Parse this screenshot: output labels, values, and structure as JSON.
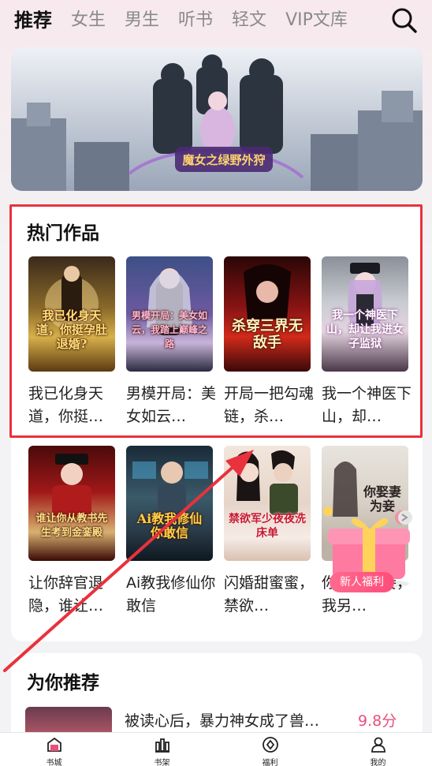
{
  "nav": {
    "tabs": [
      {
        "label": "推荐",
        "active": true
      },
      {
        "label": "女生"
      },
      {
        "label": "男生"
      },
      {
        "label": "听书"
      },
      {
        "label": "轻文"
      },
      {
        "label": "VIP文库"
      }
    ]
  },
  "banner": {
    "title": "魔女之绿野外狩"
  },
  "hot": {
    "title": "热门作品",
    "books": [
      {
        "name": "我已化身天道，你挺…",
        "cover_text": "我已化身天道，你挺孕肚退婚?"
      },
      {
        "name": "男模开局：美女如云…",
        "cover_text": "男模开局：美女如云，我踏上巅峰之路"
      },
      {
        "name": "开局一把勾魂链，杀…",
        "cover_text": "杀穿三界无敌手"
      },
      {
        "name": "我一个神医下山，却…",
        "cover_text": "我一个神医下山，却让我进女子监狱"
      }
    ]
  },
  "more_books": [
    {
      "name": "让你辞官退隐，谁让…",
      "cover_text": "谁让你从教书先生考到金銮殿"
    },
    {
      "name": "Ai教我修仙你敢信",
      "cover_text": "Ai教我修仙你敢信"
    },
    {
      "name": "闪婚甜蜜蜜，禁欲…",
      "cover_text": "禁欲军少夜夜洗床单"
    },
    {
      "name": "你娶我为妾，我另…",
      "cover_text": "你娶妻为妾"
    }
  ],
  "promo": {
    "label": "新人福利"
  },
  "recommend": {
    "title": "为你推荐",
    "item": {
      "name": "被读心后，暴力神女成了兽…",
      "score": "9.8分"
    }
  },
  "bottom_nav": [
    {
      "label": "书城",
      "active": true
    },
    {
      "label": "书架"
    },
    {
      "label": "福利"
    },
    {
      "label": "我的"
    }
  ],
  "colors": {
    "accent": "#e8507a",
    "highlight_box": "#e8323c",
    "annotation_arrow": "#e8323c"
  }
}
